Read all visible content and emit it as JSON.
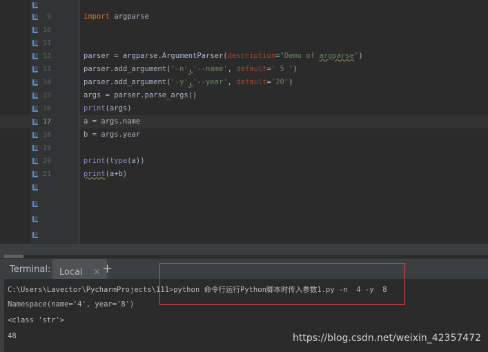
{
  "editor": {
    "line_numbers": [
      "9",
      "10",
      "11",
      "12",
      "13",
      "14",
      "15",
      "16",
      "17",
      "18",
      "19",
      "20",
      "21"
    ],
    "current_line": "17",
    "code": {
      "l9_kw": "import",
      "l9_rest": " argparse",
      "l12_a": "parser = argparse.ArgumentParser(",
      "l12_param": "description",
      "l12_eq": "=",
      "l12_str_a": "\"Demo of ",
      "l12_str_b": "argparse",
      "l12_str_c": "\"",
      "l12_close": ")",
      "l13_a": "parser.add_argument(",
      "l13_s1": "'-n'",
      "l13_comma": ",",
      "l13_s2": "'--name'",
      "l13_sep": ", ",
      "l13_param": "default",
      "l13_eq": "=",
      "l13_s3": "' 5 '",
      "l13_close": ")",
      "l14_a": "parser.add_argument(",
      "l14_s1": "'-y'",
      "l14_comma": ",",
      "l14_s2": "'--year'",
      "l14_sep": ", ",
      "l14_param": "default",
      "l14_eq": "=",
      "l14_s3": "'20'",
      "l14_close": ")",
      "l15": "args = parser.parse_args()",
      "l16_fn": "print",
      "l16_rest": "(args)",
      "l17": "a = args.name",
      "l18": "b = args.year",
      "l20_fn": "print",
      "l20_p": "(",
      "l20_fn2": "type",
      "l20_rest": "(a))",
      "l21_fn": "print",
      "l21_rest": "(a+b)"
    }
  },
  "terminal": {
    "title": "Terminal:",
    "tab_label": "Local",
    "close_glyph": "✕",
    "add_glyph": "+",
    "lines": [
      "C:\\Users\\Lavector\\PycharmProjects\\111>python 命令行运行Python脚本时传入参数1.py -n  4 -y  8",
      "Namespace(name='4', year='8')",
      "<class 'str'>",
      "48"
    ]
  },
  "watermark": "https://blog.csdn.net/weixin_42357472"
}
